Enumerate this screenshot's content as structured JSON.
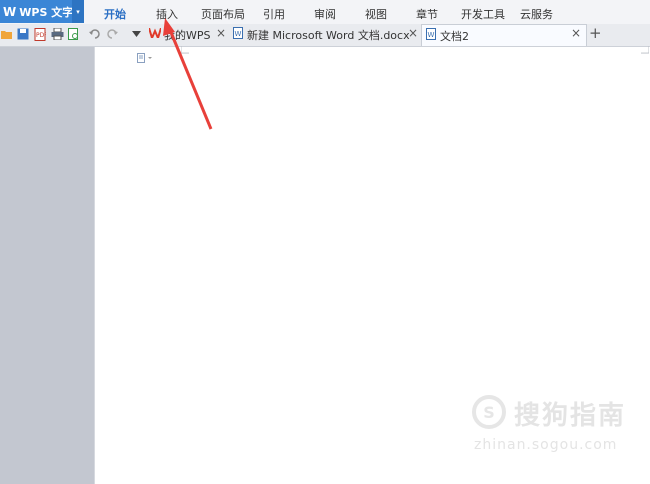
{
  "app": {
    "logo": "W",
    "name": "WPS 文字",
    "caret": "▾"
  },
  "menu": {
    "items": [
      {
        "label": "开始",
        "active": true
      },
      {
        "label": "插入",
        "active": false
      },
      {
        "label": "页面布局",
        "active": false
      },
      {
        "label": "引用",
        "active": false
      },
      {
        "label": "审阅",
        "active": false
      },
      {
        "label": "视图",
        "active": false
      },
      {
        "label": "章节",
        "active": false
      },
      {
        "label": "开发工具",
        "active": false
      },
      {
        "label": "云服务",
        "active": false
      }
    ]
  },
  "toolbar": {
    "icons": [
      "open-folder-icon",
      "save-icon",
      "export-pdf-icon",
      "print-icon",
      "print-preview-icon",
      "undo-icon",
      "redo-icon",
      "dropdown-icon"
    ]
  },
  "tabs": [
    {
      "label": "我的WPS",
      "icon": "wps-logo-icon",
      "active": false
    },
    {
      "label": "新建 Microsoft Word 文档.docx",
      "icon": "doc-icon",
      "active": false
    },
    {
      "label": "文档2",
      "icon": "doc-icon",
      "active": true
    }
  ],
  "tab_close": "×",
  "new_tab": "+",
  "watermark": {
    "title": "搜狗指南",
    "url": "zhinan.sogou.com"
  },
  "colors": {
    "accent": "#3b86d6",
    "annotation_arrow": "#e8403a"
  }
}
